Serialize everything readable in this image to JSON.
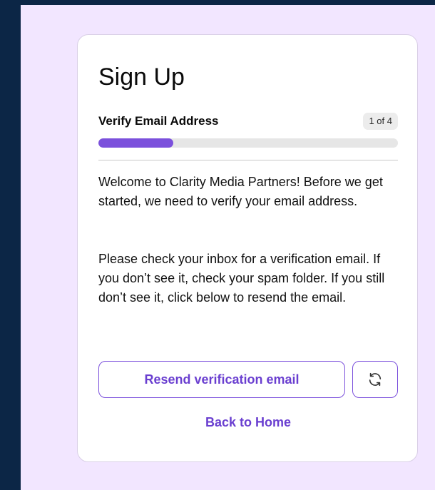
{
  "page": {
    "title": "Sign Up"
  },
  "step": {
    "title": "Verify Email Address",
    "badge": "1 of 4",
    "current": 1,
    "total": 4,
    "progress_fraction": 0.25
  },
  "content": {
    "paragraph1": "Welcome to Clarity Media Partners! Before we get started, we need to verify your email address.",
    "paragraph2": "Please check your inbox for a verification email. If you don’t see it, check your spam folder. If you still don’t see it, click below to resend the email."
  },
  "actions": {
    "resend_label": "Resend verification email",
    "refresh_icon": "refresh-icon",
    "back_label": "Back to Home"
  },
  "colors": {
    "accent": "#7b50dc",
    "accent_text": "#6a3fd0",
    "page_background": "#f2e6ff",
    "outer_background": "#0c2646",
    "card_background": "#ffffff"
  }
}
